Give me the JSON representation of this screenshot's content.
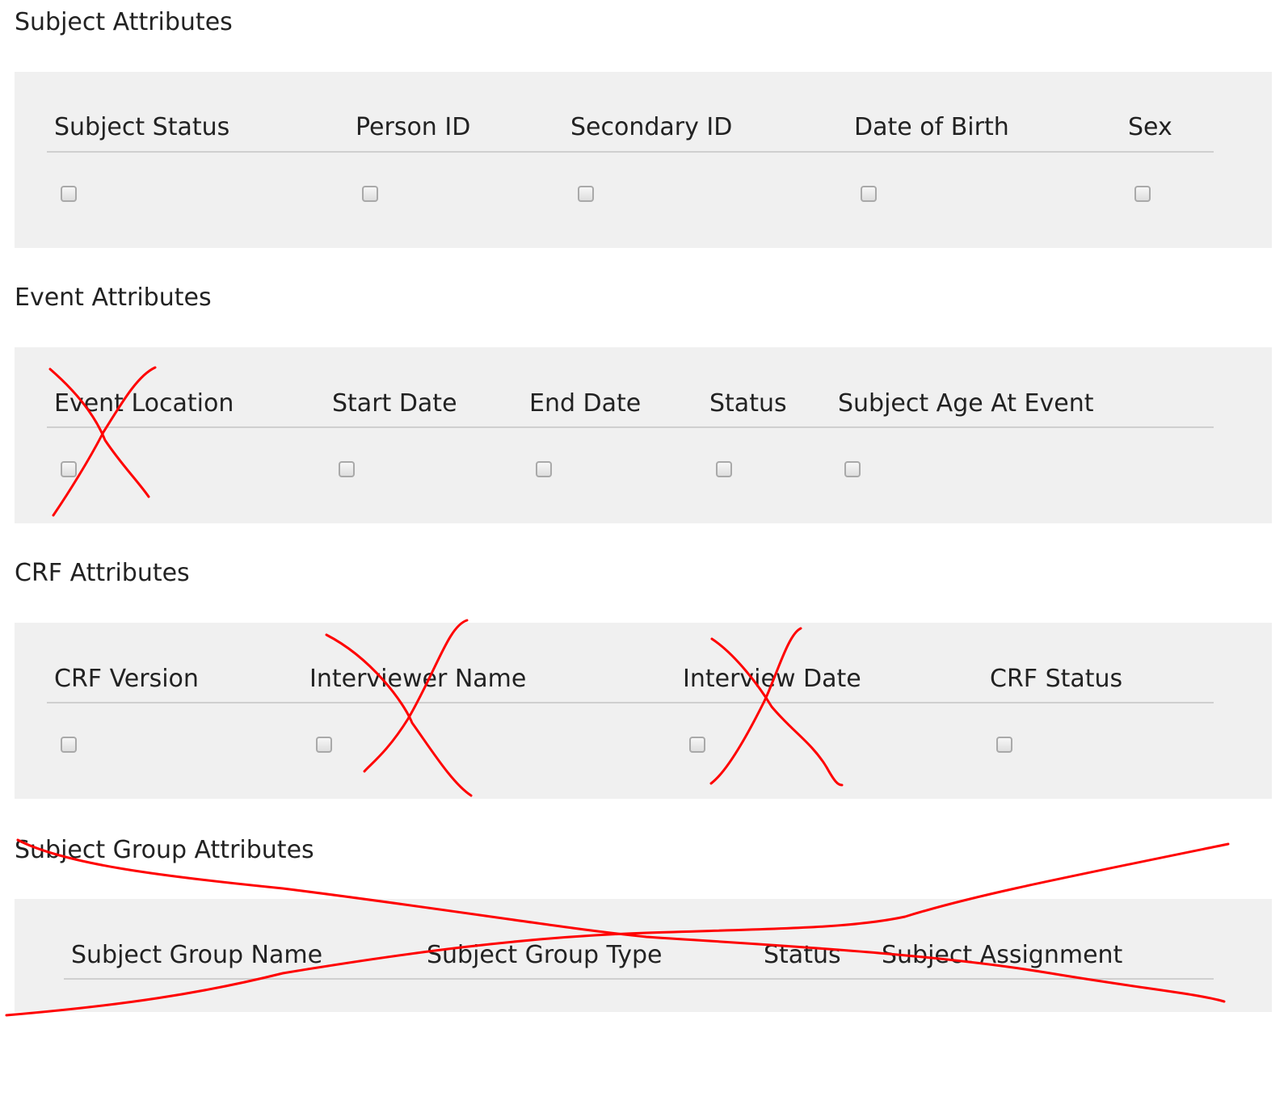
{
  "sections": {
    "subject": {
      "title": "Subject Attributes",
      "columns": [
        {
          "label": "Subject Status",
          "checked": false
        },
        {
          "label": "Person ID",
          "checked": false
        },
        {
          "label": "Secondary ID",
          "checked": false
        },
        {
          "label": "Date of Birth",
          "checked": false
        },
        {
          "label": "Sex",
          "checked": false
        }
      ]
    },
    "event": {
      "title": "Event Attributes",
      "columns": [
        {
          "label": "Event Location",
          "checked": false
        },
        {
          "label": "Start Date",
          "checked": false
        },
        {
          "label": "End Date",
          "checked": false
        },
        {
          "label": "Status",
          "checked": false
        },
        {
          "label": "Subject Age At Event",
          "checked": false
        }
      ]
    },
    "crf": {
      "title": "CRF Attributes",
      "columns": [
        {
          "label": "CRF Version",
          "checked": false
        },
        {
          "label": "Interviewer Name",
          "checked": false
        },
        {
          "label": "Interview Date",
          "checked": false
        },
        {
          "label": "CRF Status",
          "checked": false
        }
      ]
    },
    "subject_group": {
      "title": "Subject Group Attributes",
      "columns": [
        {
          "label": "Subject Group Name"
        },
        {
          "label": "Subject Group Type"
        },
        {
          "label": "Status"
        },
        {
          "label": "Subject Assignment"
        }
      ]
    }
  },
  "colors": {
    "annotation_stroke": "#ff0000",
    "panel_background": "#f0f0f0"
  }
}
